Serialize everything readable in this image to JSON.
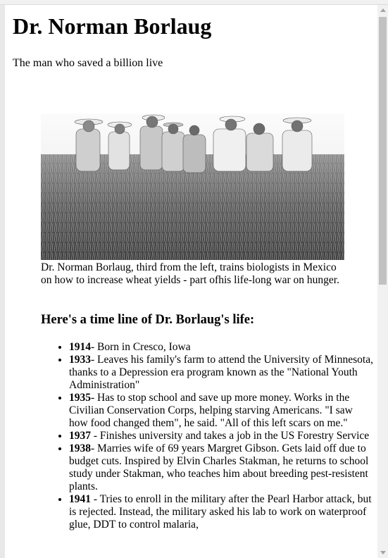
{
  "page": {
    "title": "Dr. Norman Borlaug",
    "subtitle": "The man who saved a billion live"
  },
  "figure": {
    "caption": "Dr. Norman Borlaug, third from the left, trains biologists in Mexico on how to increase wheat yields - part ofhis life-long war on hunger."
  },
  "timeline": {
    "heading": "Here's a time line of Dr. Borlaug's life:",
    "items": [
      {
        "year": "1914",
        "text": "- Born in Cresco, Iowa"
      },
      {
        "year": "1933",
        "text": "- Leaves his family's farm to attend the University of Minnesota, thanks to a Depression era program known as the \"National Youth Administration\""
      },
      {
        "year": "1935",
        "text": "- Has to stop school and save up more money. Works in the Civilian Conservation Corps, helping starving Americans. \"I saw how food changed them\", he said. \"All of this left scars on me.\""
      },
      {
        "year": "1937",
        "text": " - Finishes university and takes a job in the US Forestry Service"
      },
      {
        "year": "1938",
        "text": "- Marries wife of 69 years Margret Gibson. Gets laid off due to budget cuts. Inspired by Elvin Charles Stakman, he returns to school study under Stakman, who teaches him about breeding pest-resistent plants."
      },
      {
        "year": "1941",
        "text": " - Tries to enroll in the military after the Pearl Harbor attack, but is rejected. Instead, the military asked his lab to work on waterproof glue, DDT to control malaria,"
      }
    ]
  }
}
